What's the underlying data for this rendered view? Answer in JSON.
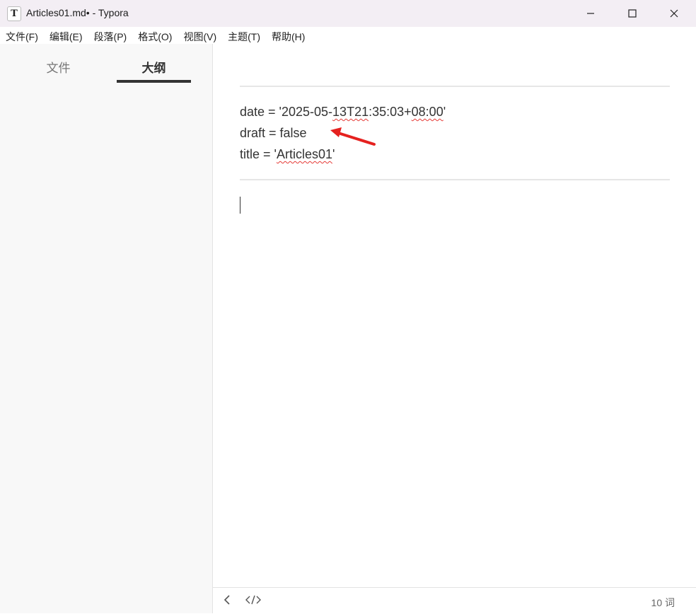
{
  "window": {
    "title": "Articles01.md• - Typora",
    "app_icon_letter": "T"
  },
  "menu": [
    {
      "label": "文件(F)"
    },
    {
      "label": "编辑(E)"
    },
    {
      "label": "段落(P)"
    },
    {
      "label": "格式(O)"
    },
    {
      "label": "视图(V)"
    },
    {
      "label": "主题(T)"
    },
    {
      "label": "帮助(H)"
    }
  ],
  "sidebar": {
    "tab_files": "文件",
    "tab_outline": "大纲",
    "active_tab": "大纲"
  },
  "editor": {
    "front_matter": {
      "date_prefix": "date = '2025-05-",
      "date_spell1": "13T21",
      "date_mid": ":35:03+",
      "date_spell2": "08:00",
      "date_suffix": "'",
      "draft_line": "draft = false",
      "title_prefix": "title = '",
      "title_spell": "Articles01",
      "title_suffix": "'"
    }
  },
  "status": {
    "word_count": "10 词"
  },
  "colors": {
    "arrow": "#e5211f",
    "spellcheck": "#e53935",
    "titlebar": "#f3eef4"
  }
}
